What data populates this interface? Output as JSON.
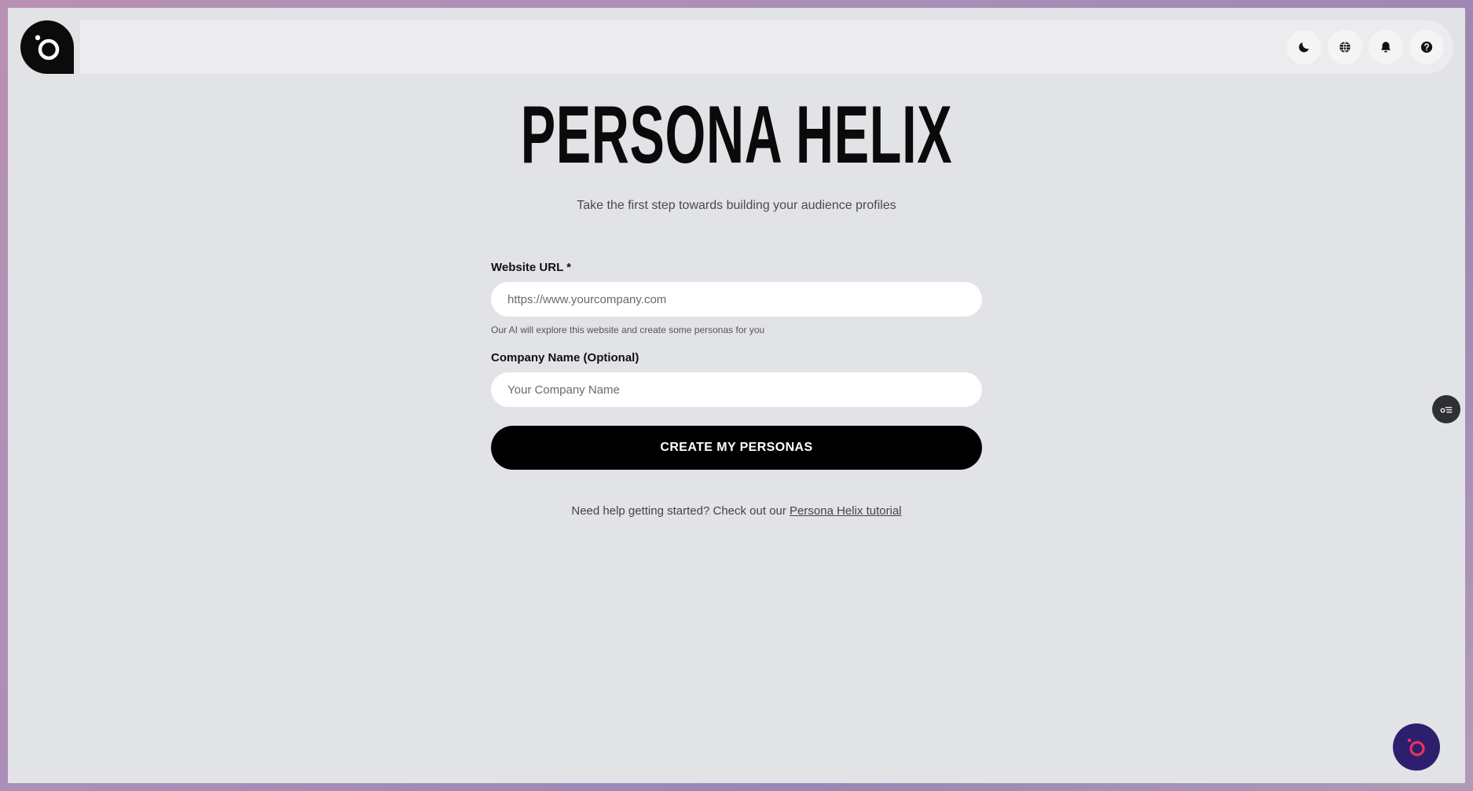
{
  "app": {
    "title": "PERSONA HELIX",
    "subtitle": "Take the first step towards building your audience profiles"
  },
  "topbar": {
    "icons": [
      "moon-icon",
      "globe-icon",
      "bell-icon",
      "help-icon"
    ]
  },
  "form": {
    "website_label": "Website URL *",
    "website_placeholder": "https://www.yourcompany.com",
    "website_value": "",
    "website_help": "Our AI will explore this website and create some personas for you",
    "company_label": "Company Name (Optional)",
    "company_placeholder": "Your Company Name",
    "company_value": "",
    "submit_label": "CREATE MY PERSONAS"
  },
  "footer": {
    "prefix": "Need help getting started? Check out our",
    "link": "Persona Helix tutorial"
  },
  "colors": {
    "primary": "#000000",
    "background": "#e2e3e6",
    "chat": "#2d1f6e",
    "chat_accent": "#e8345a"
  }
}
